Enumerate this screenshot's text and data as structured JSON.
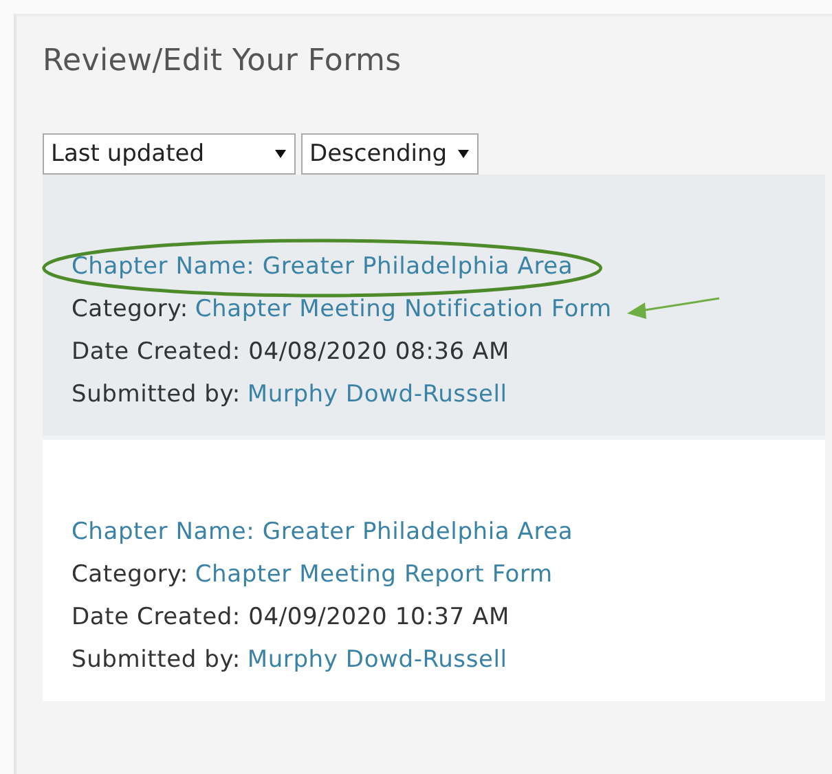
{
  "title": "Review/Edit Your Forms",
  "sort_controls": [
    {
      "value": "Last updated"
    },
    {
      "value": "Descending"
    }
  ],
  "forms": [
    {
      "selected": true,
      "circled": true,
      "arrow": true,
      "chapter_name": "Chapter Name: Greater Philadelphia Area",
      "category_label": "Category:",
      "category": "Chapter Meeting Notification Form",
      "date_created": "Date Created: 04/08/2020 08:36 AM",
      "submitted_label": "Submitted by:",
      "submitted_by": "Murphy Dowd-Russell"
    },
    {
      "selected": false,
      "circled": false,
      "arrow": false,
      "chapter_name": "Chapter Name: Greater Philadelphia Area",
      "category_label": "Category:",
      "category": "Chapter Meeting Report Form",
      "date_created": "Date Created: 04/09/2020 10:37 AM",
      "submitted_label": "Submitted by:",
      "submitted_by": "Murphy Dowd-Russell"
    }
  ]
}
